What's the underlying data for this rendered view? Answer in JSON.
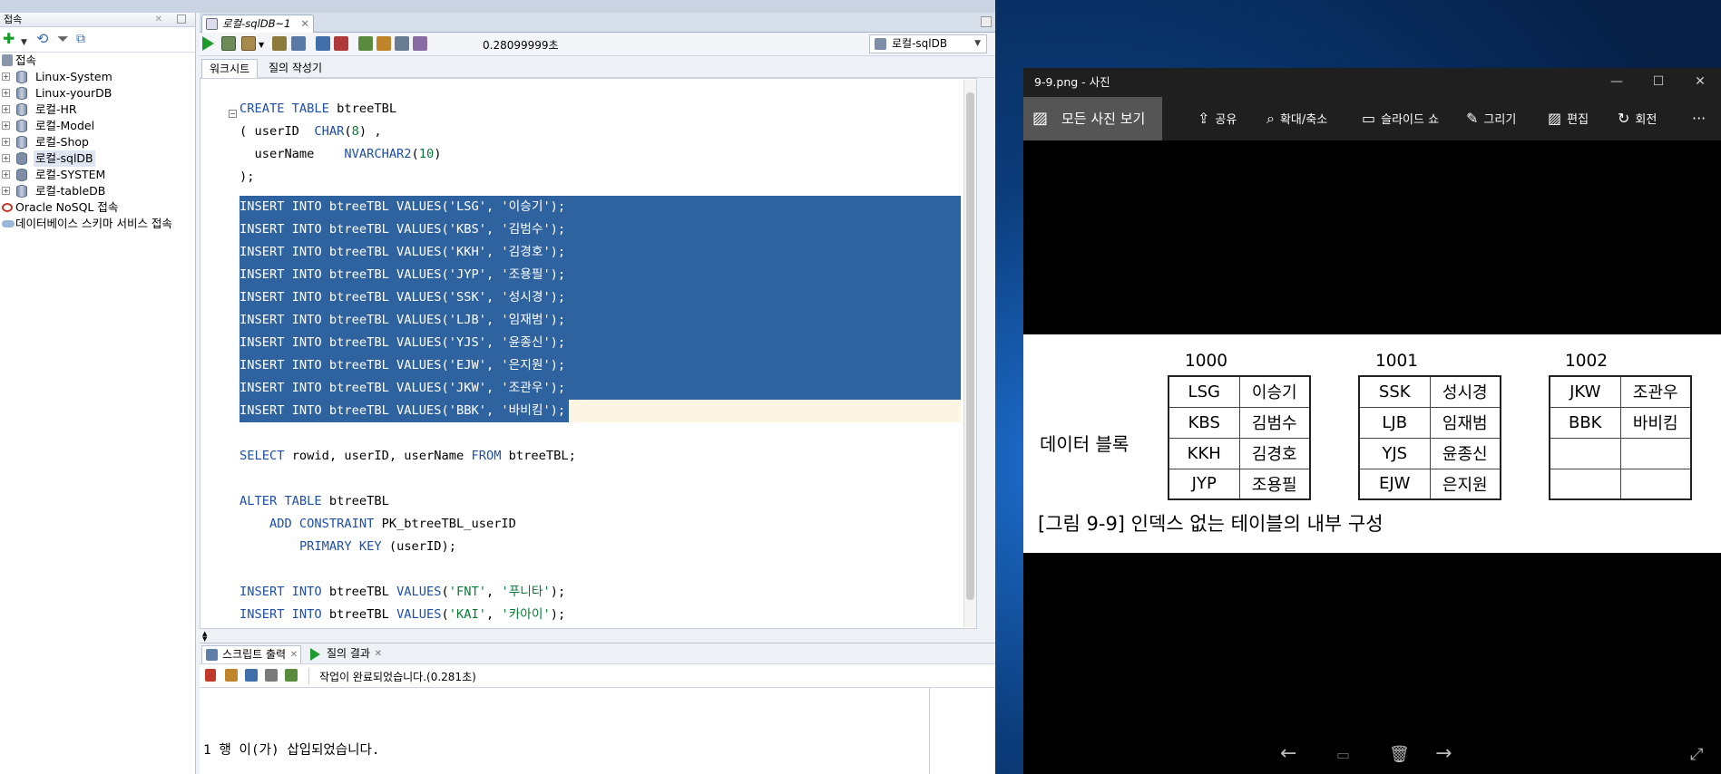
{
  "sqldev": {
    "connections": {
      "panel_title": "접속",
      "items": [
        {
          "label": "접속",
          "root": true
        },
        {
          "label": "Linux-System"
        },
        {
          "label": "Linux-yourDB"
        },
        {
          "label": "로컬-HR"
        },
        {
          "label": "로컬-Model"
        },
        {
          "label": "로컬-Shop"
        },
        {
          "label": "로컬-sqlDB",
          "selected": true
        },
        {
          "label": "로컬-SYSTEM"
        },
        {
          "label": "로컬-tableDB"
        },
        {
          "label": "Oracle NoSQL 접속"
        },
        {
          "label": "데이터베이스 스키마 서비스 접속"
        }
      ]
    },
    "editor_tab": {
      "label": "로컬-sqlDB~1"
    },
    "toolbar": {
      "elapsed": "0.28099999초",
      "connection": "로컬-sqlDB"
    },
    "subtabs": {
      "worksheet": "워크시트",
      "query_builder": "질의 작성기"
    },
    "code_lines": [
      "CREATE TABLE btreeTBL",
      "( userID  CHAR(8) ,",
      "  userName    NVARCHAR2(10)",
      ");",
      "INSERT INTO btreeTBL VALUES('LSG', '이승기');",
      "INSERT INTO btreeTBL VALUES('KBS', '김범수');",
      "INSERT INTO btreeTBL VALUES('KKH', '김경호');",
      "INSERT INTO btreeTBL VALUES('JYP', '조용필');",
      "INSERT INTO btreeTBL VALUES('SSK', '성시경');",
      "INSERT INTO btreeTBL VALUES('LJB', '임재범');",
      "INSERT INTO btreeTBL VALUES('YJS', '윤종신');",
      "INSERT INTO btreeTBL VALUES('EJW', '은지원');",
      "INSERT INTO btreeTBL VALUES('JKW', '조관우');",
      "INSERT INTO btreeTBL VALUES('BBK', '바비킴');",
      "",
      "SELECT rowid, userID, userName FROM btreeTBL;",
      "",
      "ALTER TABLE btreeTBL",
      "    ADD CONSTRAINT PK_btreeTBL_userID",
      "        PRIMARY KEY (userID);",
      "",
      "INSERT INTO btreeTBL VALUES('FNT', '푸니타');",
      "INSERT INTO btreeTBL VALUES('KAI', '카아이');"
    ],
    "output": {
      "tab_script": "스크립트 출력",
      "tab_result": "질의 결과",
      "status": "작업이 완료되었습니다.(0.281초)",
      "text": "1 행 이(가) 삽입되었습니다."
    }
  },
  "photos": {
    "title": "9-9.png - 사진",
    "all_photos": "모든 사진 보기",
    "toolbar": [
      {
        "label": "공유",
        "icon": "share-icon",
        "glyph": "⇪"
      },
      {
        "label": "확대/축소",
        "icon": "zoom-icon",
        "glyph": "⌕"
      },
      {
        "label": "슬라이드 쇼",
        "icon": "slideshow-icon",
        "glyph": "▭"
      },
      {
        "label": "그리기",
        "icon": "draw-icon",
        "glyph": "✎"
      },
      {
        "label": "편집",
        "icon": "edit-icon",
        "glyph": "▨"
      },
      {
        "label": "회전",
        "icon": "rotate-icon",
        "glyph": "↻"
      }
    ],
    "more": "···",
    "figure": {
      "block_label": "데이터 블록",
      "caption": "[그림 9-9] 인덱스 없는 테이블의 내부 구성",
      "blocks": [
        {
          "no": "1000",
          "rows": [
            [
              "LSG",
              "이승기"
            ],
            [
              "KBS",
              "김범수"
            ],
            [
              "KKH",
              "김경호"
            ],
            [
              "JYP",
              "조용필"
            ]
          ]
        },
        {
          "no": "1001",
          "rows": [
            [
              "SSK",
              "성시경"
            ],
            [
              "LJB",
              "임재범"
            ],
            [
              "YJS",
              "윤종신"
            ],
            [
              "EJW",
              "은지원"
            ]
          ]
        },
        {
          "no": "1002",
          "rows": [
            [
              "JKW",
              "조관우"
            ],
            [
              "BBK",
              "바비킴"
            ],
            [
              "",
              ""
            ],
            [
              "",
              ""
            ]
          ]
        }
      ]
    }
  }
}
